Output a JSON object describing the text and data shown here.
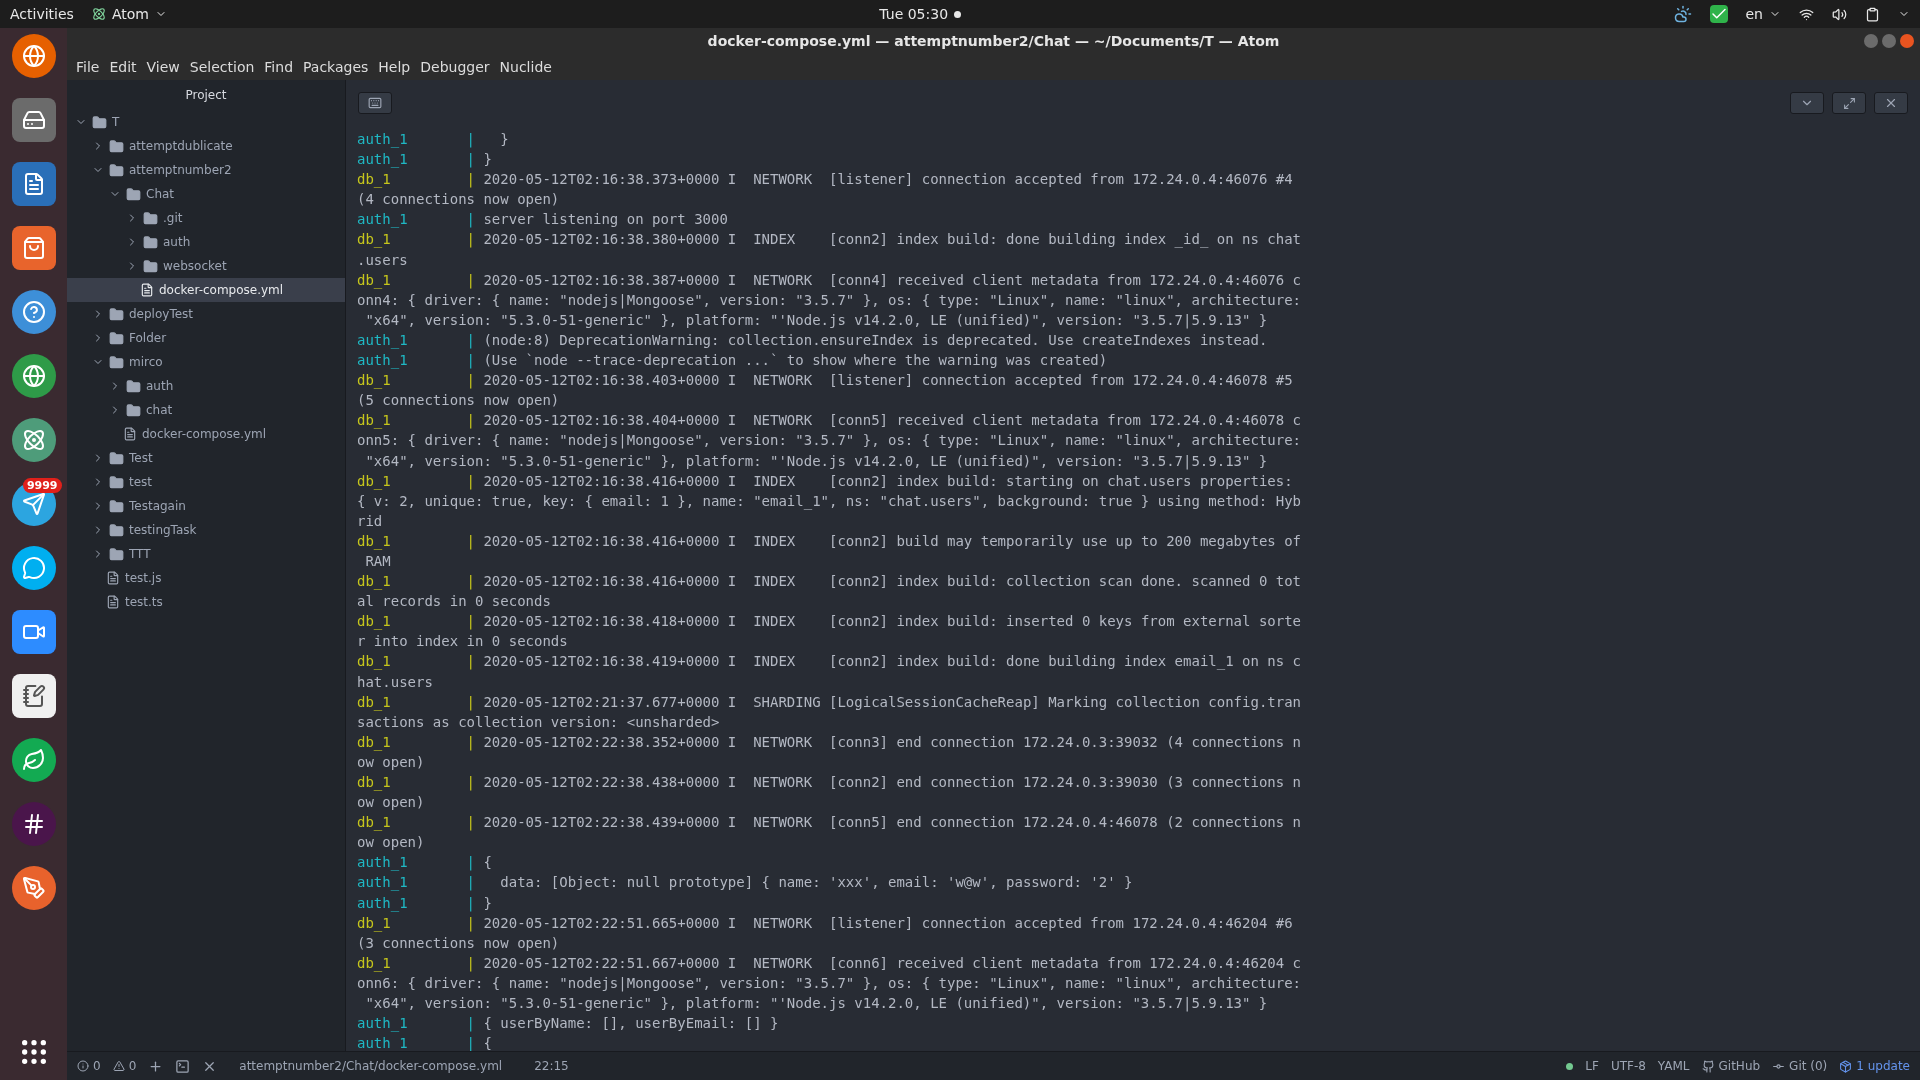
{
  "top_bar": {
    "activities": "Activities",
    "app": "Atom",
    "clock": "Tue 05:30",
    "language": "en"
  },
  "dock": {
    "badge": "9999"
  },
  "window": {
    "title": "docker-compose.yml — attemptnumber2/Chat — ~/Documents/T — Atom"
  },
  "menu": [
    "File",
    "Edit",
    "View",
    "Selection",
    "Find",
    "Packages",
    "Help",
    "Debugger",
    "Nuclide"
  ],
  "sidebar": {
    "title": "Project",
    "tree": [
      {
        "label": "T",
        "kind": "folder",
        "expanded": true,
        "selected": false,
        "children": [
          {
            "label": "attemptdublicate",
            "kind": "folder",
            "expanded": false,
            "selected": false
          },
          {
            "label": "attemptnumber2",
            "kind": "folder",
            "expanded": true,
            "selected": false,
            "children": [
              {
                "label": "Chat",
                "kind": "folder",
                "expanded": true,
                "selected": false,
                "children": [
                  {
                    "label": ".git",
                    "kind": "folder",
                    "expanded": false,
                    "selected": false
                  },
                  {
                    "label": "auth",
                    "kind": "folder",
                    "expanded": false,
                    "selected": false
                  },
                  {
                    "label": "websocket",
                    "kind": "folder",
                    "expanded": false,
                    "selected": false
                  },
                  {
                    "label": "docker-compose.yml",
                    "kind": "file",
                    "selected": true
                  }
                ]
              }
            ]
          },
          {
            "label": "deployTest",
            "kind": "folder",
            "expanded": false,
            "selected": false
          },
          {
            "label": "Folder",
            "kind": "folder",
            "expanded": false,
            "selected": false
          },
          {
            "label": "mirco",
            "kind": "folder",
            "expanded": true,
            "selected": false,
            "children": [
              {
                "label": "auth",
                "kind": "folder",
                "expanded": false,
                "selected": false
              },
              {
                "label": "chat",
                "kind": "folder",
                "expanded": false,
                "selected": false
              },
              {
                "label": "docker-compose.yml",
                "kind": "file",
                "selected": false
              }
            ]
          },
          {
            "label": "Test",
            "kind": "folder",
            "expanded": false,
            "selected": false
          },
          {
            "label": "test",
            "kind": "folder",
            "expanded": false,
            "selected": false
          },
          {
            "label": "Testagain",
            "kind": "folder",
            "expanded": false,
            "selected": false
          },
          {
            "label": "testingTask",
            "kind": "folder",
            "expanded": false,
            "selected": false
          },
          {
            "label": "TTT",
            "kind": "folder",
            "expanded": false,
            "selected": false
          },
          {
            "label": "test.js",
            "kind": "file",
            "selected": false
          },
          {
            "label": "test.ts",
            "kind": "file",
            "selected": false
          }
        ]
      }
    ]
  },
  "terminal": [
    {
      "prefix": "auth_1       |",
      "color": "#1fb8c4",
      "lines": [
        "  }"
      ]
    },
    {
      "prefix": "auth_1       |",
      "color": "#1fb8c4",
      "lines": [
        "}"
      ]
    },
    {
      "prefix": "db_1         |",
      "color": "#c6c61c",
      "lines": [
        "2020-05-12T02:16:38.373+0000 I  NETWORK  [listener] connection accepted from 172.24.0.4:46076 #4",
        "(4 connections now open)"
      ]
    },
    {
      "prefix": "auth_1       |",
      "color": "#1fb8c4",
      "lines": [
        "server listening on port 3000"
      ]
    },
    {
      "prefix": "db_1         |",
      "color": "#c6c61c",
      "lines": [
        "2020-05-12T02:16:38.380+0000 I  INDEX    [conn2] index build: done building index _id_ on ns chat",
        ".users"
      ]
    },
    {
      "prefix": "db_1         |",
      "color": "#c6c61c",
      "lines": [
        "2020-05-12T02:16:38.387+0000 I  NETWORK  [conn4] received client metadata from 172.24.0.4:46076 c",
        "onn4: { driver: { name: \"nodejs|Mongoose\", version: \"3.5.7\" }, os: { type: \"Linux\", name: \"linux\", architecture:",
        " \"x64\", version: \"5.3.0-51-generic\" }, platform: \"'Node.js v14.2.0, LE (unified)\", version: \"3.5.7|5.9.13\" }"
      ]
    },
    {
      "prefix": "auth_1       |",
      "color": "#1fb8c4",
      "lines": [
        "(node:8) DeprecationWarning: collection.ensureIndex is deprecated. Use createIndexes instead."
      ]
    },
    {
      "prefix": "auth_1       |",
      "color": "#1fb8c4",
      "lines": [
        "(Use `node --trace-deprecation ...` to show where the warning was created)"
      ]
    },
    {
      "prefix": "db_1         |",
      "color": "#c6c61c",
      "lines": [
        "2020-05-12T02:16:38.403+0000 I  NETWORK  [listener] connection accepted from 172.24.0.4:46078 #5",
        "(5 connections now open)"
      ]
    },
    {
      "prefix": "db_1         |",
      "color": "#c6c61c",
      "lines": [
        "2020-05-12T02:16:38.404+0000 I  NETWORK  [conn5] received client metadata from 172.24.0.4:46078 c",
        "onn5: { driver: { name: \"nodejs|Mongoose\", version: \"3.5.7\" }, os: { type: \"Linux\", name: \"linux\", architecture:",
        " \"x64\", version: \"5.3.0-51-generic\" }, platform: \"'Node.js v14.2.0, LE (unified)\", version: \"3.5.7|5.9.13\" }"
      ]
    },
    {
      "prefix": "db_1         |",
      "color": "#c6c61c",
      "lines": [
        "2020-05-12T02:16:38.416+0000 I  INDEX    [conn2] index build: starting on chat.users properties:",
        "{ v: 2, unique: true, key: { email: 1 }, name: \"email_1\", ns: \"chat.users\", background: true } using method: Hyb",
        "rid"
      ]
    },
    {
      "prefix": "db_1         |",
      "color": "#c6c61c",
      "lines": [
        "2020-05-12T02:16:38.416+0000 I  INDEX    [conn2] build may temporarily use up to 200 megabytes of",
        " RAM"
      ]
    },
    {
      "prefix": "db_1         |",
      "color": "#c6c61c",
      "lines": [
        "2020-05-12T02:16:38.416+0000 I  INDEX    [conn2] index build: collection scan done. scanned 0 tot",
        "al records in 0 seconds"
      ]
    },
    {
      "prefix": "db_1         |",
      "color": "#c6c61c",
      "lines": [
        "2020-05-12T02:16:38.418+0000 I  INDEX    [conn2] index build: inserted 0 keys from external sorte",
        "r into index in 0 seconds"
      ]
    },
    {
      "prefix": "db_1         |",
      "color": "#c6c61c",
      "lines": [
        "2020-05-12T02:16:38.419+0000 I  INDEX    [conn2] index build: done building index email_1 on ns c",
        "hat.users"
      ]
    },
    {
      "prefix": "db_1         |",
      "color": "#c6c61c",
      "lines": [
        "2020-05-12T02:21:37.677+0000 I  SHARDING [LogicalSessionCacheReap] Marking collection config.tran",
        "sactions as collection version: <unsharded>"
      ]
    },
    {
      "prefix": "db_1         |",
      "color": "#c6c61c",
      "lines": [
        "2020-05-12T02:22:38.352+0000 I  NETWORK  [conn3] end connection 172.24.0.3:39032 (4 connections n",
        "ow open)"
      ]
    },
    {
      "prefix": "db_1         |",
      "color": "#c6c61c",
      "lines": [
        "2020-05-12T02:22:38.438+0000 I  NETWORK  [conn2] end connection 172.24.0.3:39030 (3 connections n",
        "ow open)"
      ]
    },
    {
      "prefix": "db_1         |",
      "color": "#c6c61c",
      "lines": [
        "2020-05-12T02:22:38.439+0000 I  NETWORK  [conn5] end connection 172.24.0.4:46078 (2 connections n",
        "ow open)"
      ]
    },
    {
      "prefix": "auth_1       |",
      "color": "#1fb8c4",
      "lines": [
        "{"
      ]
    },
    {
      "prefix": "auth_1       |",
      "color": "#1fb8c4",
      "lines": [
        "  data: [Object: null prototype] { name: 'xxx', email: 'w@w', password: '2' }"
      ]
    },
    {
      "prefix": "auth_1       |",
      "color": "#1fb8c4",
      "lines": [
        "}"
      ]
    },
    {
      "prefix": "db_1         |",
      "color": "#c6c61c",
      "lines": [
        "2020-05-12T02:22:51.665+0000 I  NETWORK  [listener] connection accepted from 172.24.0.4:46204 #6",
        "(3 connections now open)"
      ]
    },
    {
      "prefix": "db_1         |",
      "color": "#c6c61c",
      "lines": [
        "2020-05-12T02:22:51.667+0000 I  NETWORK  [conn6] received client metadata from 172.24.0.4:46204 c",
        "onn6: { driver: { name: \"nodejs|Mongoose\", version: \"3.5.7\" }, os: { type: \"Linux\", name: \"linux\", architecture:",
        " \"x64\", version: \"5.3.0-51-generic\" }, platform: \"'Node.js v14.2.0, LE (unified)\", version: \"3.5.7|5.9.13\" }"
      ]
    },
    {
      "prefix": "auth_1       |",
      "color": "#1fb8c4",
      "lines": [
        "{ userByName: [], userByEmail: [] }"
      ]
    },
    {
      "prefix": "auth_1       |",
      "color": "#1fb8c4",
      "lines": [
        "{"
      ]
    }
  ],
  "status_bar": {
    "errors": "0",
    "warnings": "0",
    "path": "attemptnumber2/Chat/docker-compose.yml",
    "cursor": "22:15",
    "line_ending": "LF",
    "encoding": "UTF-8",
    "grammar": "YAML",
    "github": "GitHub",
    "git": "Git (0)",
    "update": "1 update"
  }
}
